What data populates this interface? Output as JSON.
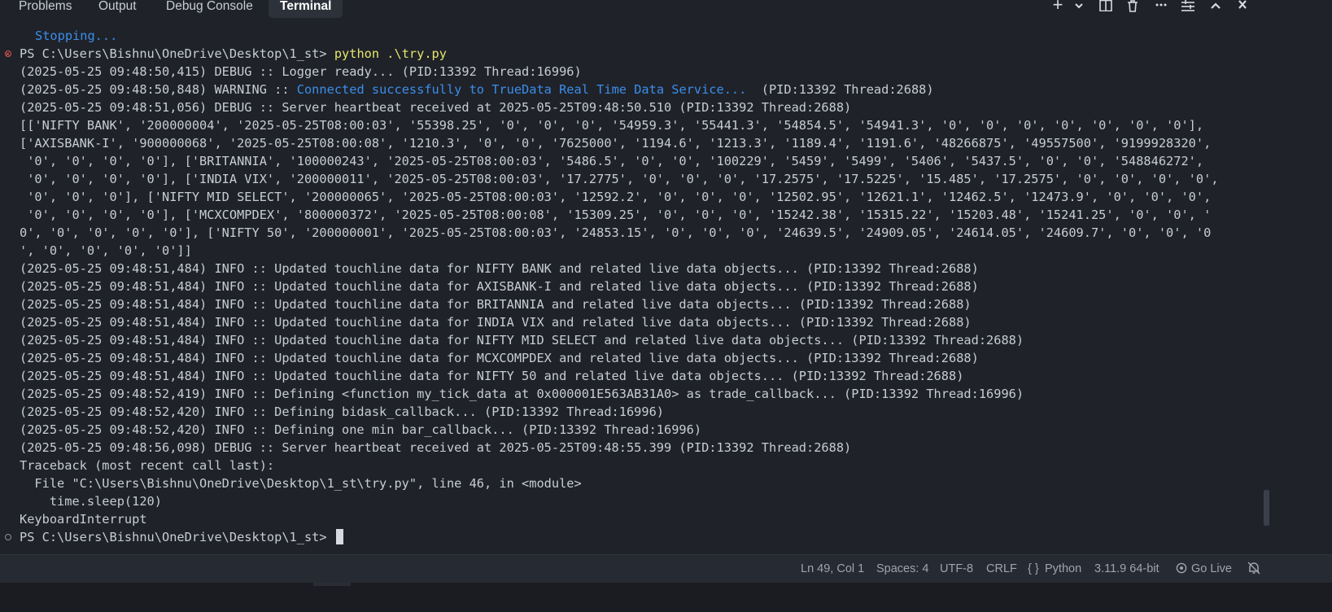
{
  "tabs": [
    "Problems",
    "Output",
    "Debug Console",
    "Terminal"
  ],
  "active_tab": "Terminal",
  "toolbar_icons": [
    "plus-icon",
    "chevron-down-icon",
    "split-icon",
    "trash-icon",
    "more-icon",
    "layout-icon",
    "chevron-up-icon",
    "close-icon"
  ],
  "terminal": {
    "stopping": "Stopping...",
    "prompt": "PS C:\\Users\\Bishnu\\OneDrive\\Desktop\\1_st> ",
    "command": "python .\\try.py",
    "logs_before": [
      "(2025-05-25 09:48:50,415) DEBUG :: Logger ready... (PID:13392 Thread:16996)"
    ],
    "warning_prefix": "(2025-05-25 09:48:50,848) WARNING :: ",
    "warning_msg": "Connected successfully to TrueData Real Time Data Service...",
    "warning_suffix": "  (PID:13392 Thread:2688)",
    "logs_after": [
      "(2025-05-25 09:48:51,056) DEBUG :: Server heartbeat received at 2025-05-25T09:48:50.510 (PID:13392 Thread:2688)",
      "[['NIFTY BANK', '200000004', '2025-05-25T08:00:03', '55398.25', '0', '0', '0', '54959.3', '55441.3', '54854.5', '54941.3', '0', '0', '0', '0', '0', '0', '0'],",
      "['AXISBANK-I', '900000068', '2025-05-25T08:00:08', '1210.3', '0', '0', '7625000', '1194.6', '1213.3', '1189.4', '1191.6', '48266875', '49557500', '9199928320',",
      " '0', '0', '0', '0'], ['BRITANNIA', '100000243', '2025-05-25T08:00:03', '5486.5', '0', '0', '100229', '5459', '5499', '5406', '5437.5', '0', '0', '548846272',",
      " '0', '0', '0', '0'], ['INDIA VIX', '200000011', '2025-05-25T08:00:03', '17.2775', '0', '0', '0', '17.2575', '17.5225', '15.485', '17.2575', '0', '0', '0', '0',",
      " '0', '0', '0'], ['NIFTY MID SELECT', '200000065', '2025-05-25T08:00:03', '12592.2', '0', '0', '0', '12502.95', '12621.1', '12462.5', '12473.9', '0', '0', '0',",
      " '0', '0', '0', '0'], ['MCXCOMPDEX', '800000372', '2025-05-25T08:00:08', '15309.25', '0', '0', '0', '15242.38', '15315.22', '15203.48', '15241.25', '0', '0', '",
      "0', '0', '0', '0', '0'], ['NIFTY 50', '200000001', '2025-05-25T08:00:03', '24853.15', '0', '0', '0', '24639.5', '24909.05', '24614.05', '24609.7', '0', '0', '0",
      "', '0', '0', '0', '0']]",
      "(2025-05-25 09:48:51,484) INFO :: Updated touchline data for NIFTY BANK and related live data objects... (PID:13392 Thread:2688)",
      "(2025-05-25 09:48:51,484) INFO :: Updated touchline data for AXISBANK-I and related live data objects... (PID:13392 Thread:2688)",
      "(2025-05-25 09:48:51,484) INFO :: Updated touchline data for BRITANNIA and related live data objects... (PID:13392 Thread:2688)",
      "(2025-05-25 09:48:51,484) INFO :: Updated touchline data for INDIA VIX and related live data objects... (PID:13392 Thread:2688)",
      "(2025-05-25 09:48:51,484) INFO :: Updated touchline data for NIFTY MID SELECT and related live data objects... (PID:13392 Thread:2688)",
      "(2025-05-25 09:48:51,484) INFO :: Updated touchline data for MCXCOMPDEX and related live data objects... (PID:13392 Thread:2688)",
      "(2025-05-25 09:48:51,484) INFO :: Updated touchline data for NIFTY 50 and related live data objects... (PID:13392 Thread:2688)",
      "(2025-05-25 09:48:52,419) INFO :: Defining <function my_tick_data at 0x000001E563AB31A0> as trade_callback... (PID:13392 Thread:16996)",
      "(2025-05-25 09:48:52,420) INFO :: Defining bidask_callback... (PID:13392 Thread:16996)",
      "(2025-05-25 09:48:52,420) INFO :: Defining one min bar_callback... (PID:13392 Thread:16996)",
      "(2025-05-25 09:48:56,098) DEBUG :: Server heartbeat received at 2025-05-25T09:48:55.399 (PID:13392 Thread:2688)",
      "Traceback (most recent call last):",
      "  File \"C:\\Users\\Bishnu\\OneDrive\\Desktop\\1_st\\try.py\", line 46, in <module>",
      "    time.sleep(120)",
      "KeyboardInterrupt"
    ],
    "final_prompt": "PS C:\\Users\\Bishnu\\OneDrive\\Desktop\\1_st> "
  },
  "status": {
    "position": "Ln 49, Col 1",
    "spaces": "Spaces: 4",
    "encoding": "UTF-8",
    "eol": "CRLF",
    "language_icon": "{ }",
    "language": "Python",
    "interpreter": "3.11.9 64-bit",
    "go_live": "Go Live"
  },
  "colors": {
    "background": "#1f2229",
    "command": "#e5e56b",
    "link": "#3b8eea",
    "error_marker": "#e05252"
  }
}
